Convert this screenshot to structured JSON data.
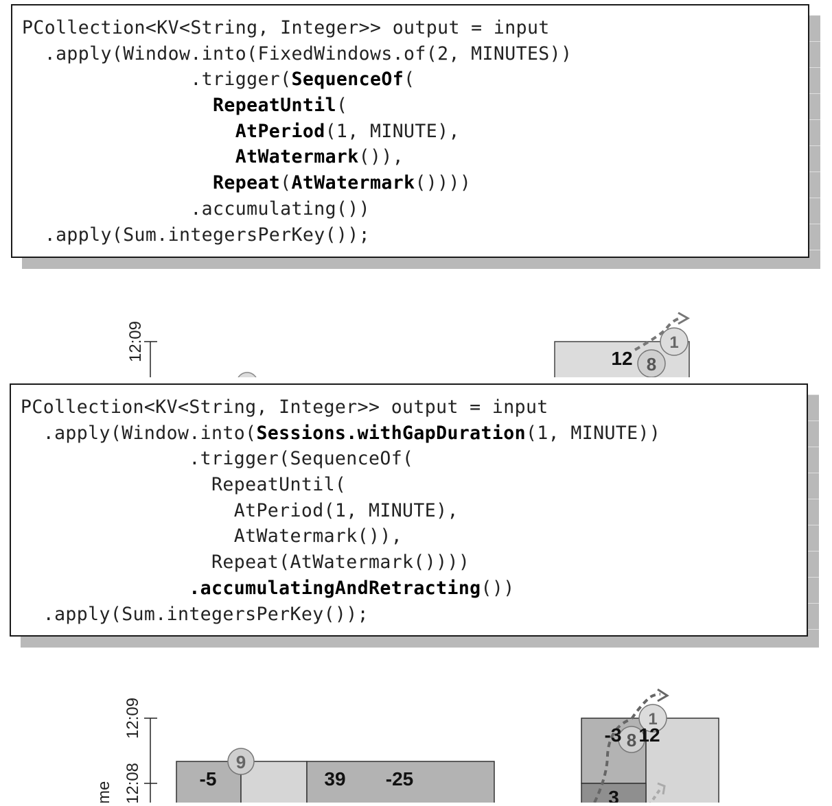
{
  "listing1": {
    "lines": [
      [
        {
          "t": "PCollection<KV<String, Integer>> output = input",
          "b": false
        }
      ],
      [
        {
          "t": "  .apply(Window.into(FixedWindows.of(2, MINUTES))",
          "b": false
        }
      ],
      [
        {
          "t": "               .trigger(",
          "b": false
        },
        {
          "t": "SequenceOf",
          "b": true
        },
        {
          "t": "(",
          "b": false
        }
      ],
      [
        {
          "t": "                 ",
          "b": false
        },
        {
          "t": "RepeatUntil",
          "b": true
        },
        {
          "t": "(",
          "b": false
        }
      ],
      [
        {
          "t": "                   ",
          "b": false
        },
        {
          "t": "AtPeriod",
          "b": true
        },
        {
          "t": "(1, MINUTE),",
          "b": false
        }
      ],
      [
        {
          "t": "                   ",
          "b": false
        },
        {
          "t": "AtWatermark",
          "b": true
        },
        {
          "t": "()),",
          "b": false
        }
      ],
      [
        {
          "t": "                 ",
          "b": false
        },
        {
          "t": "Repeat",
          "b": true
        },
        {
          "t": "(",
          "b": false
        },
        {
          "t": "AtWatermark",
          "b": true
        },
        {
          "t": "())))",
          "b": false
        }
      ],
      [
        {
          "t": "               .accumulating())",
          "b": false
        }
      ],
      [
        {
          "t": "  .apply(Sum.integersPerKey());",
          "b": false
        }
      ]
    ]
  },
  "listing2": {
    "lines": [
      [
        {
          "t": "PCollection<KV<String, Integer>> output = input",
          "b": false
        }
      ],
      [
        {
          "t": "  .apply(Window.into(",
          "b": false
        },
        {
          "t": "Sessions.withGapDuration",
          "b": true
        },
        {
          "t": "(1, MINUTE))",
          "b": false
        }
      ],
      [
        {
          "t": "               .trigger(SequenceOf(",
          "b": false
        }
      ],
      [
        {
          "t": "                 RepeatUntil(",
          "b": false
        }
      ],
      [
        {
          "t": "                   AtPeriod(1, MINUTE),",
          "b": false
        }
      ],
      [
        {
          "t": "                   AtWatermark()),",
          "b": false
        }
      ],
      [
        {
          "t": "                 Repeat(AtWatermark())))",
          "b": false
        }
      ],
      [
        {
          "t": "               ",
          "b": false
        },
        {
          "t": ".accumulatingAndRetracting",
          "b": true
        },
        {
          "t": "())",
          "b": false
        }
      ],
      [
        {
          "t": "  .apply(Sum.integersPerKey());",
          "b": false
        }
      ]
    ]
  },
  "diagram1": {
    "axis_top_label": "12:09",
    "pane_value": "12",
    "marker_8": "8",
    "marker_1": "1"
  },
  "diagram2": {
    "axis_top_label": "12:09",
    "axis_mid_label": "12:08",
    "axis_title_fragment": "me",
    "left_values": [
      "-5",
      "39",
      "-25"
    ],
    "left_marker": "9",
    "right_top_values": [
      "-3",
      "12"
    ],
    "right_marker_8": "8",
    "right_marker_1": "1",
    "right_bottom_value": "3"
  }
}
